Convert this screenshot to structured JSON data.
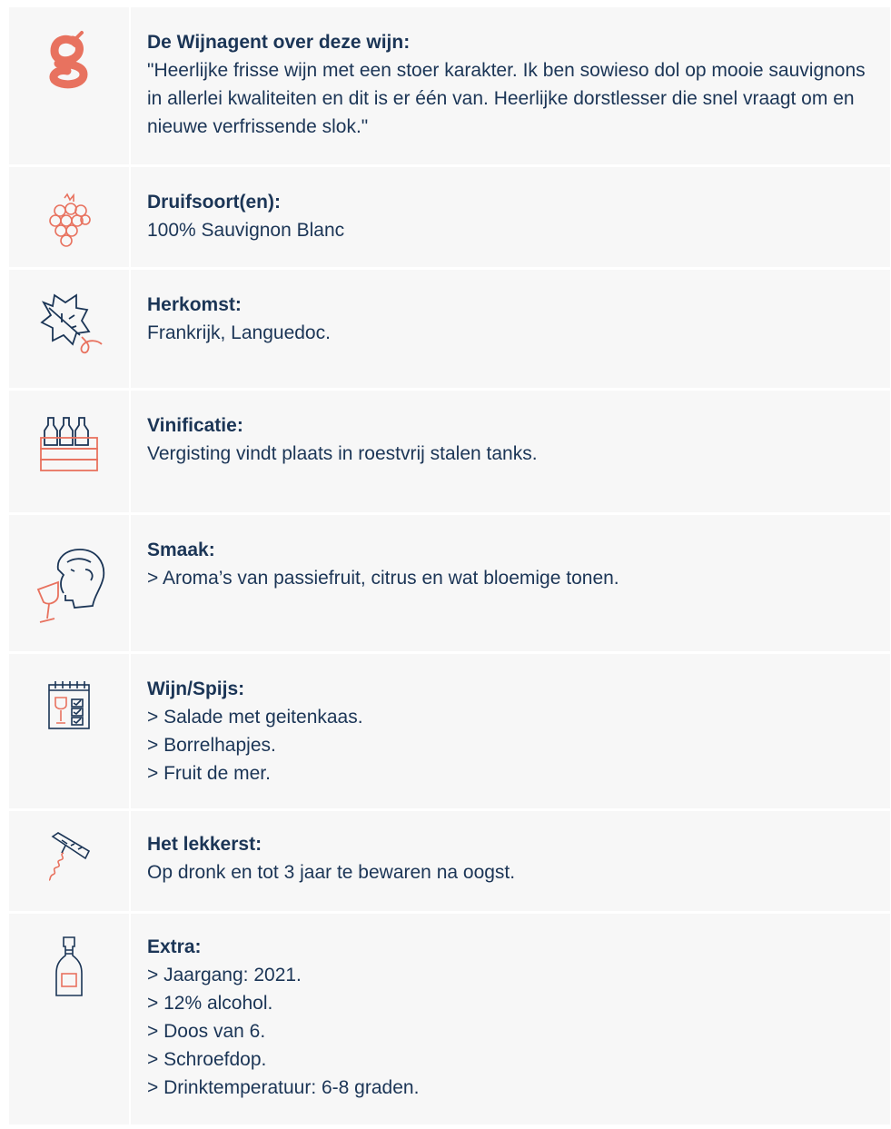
{
  "accent_color": "#e8725f",
  "navy_color": "#1b3556",
  "rows": [
    {
      "icon": "wijnagent-logo-icon",
      "label": "De Wijnagent over deze wijn:",
      "lines": [
        "\"Heerlijke frisse wijn met een stoer karakter. Ik ben sowieso dol op mooie sauvignons in allerlei kwaliteiten en dit is er één van. Heerlijke dorstlesser die snel vraagt om en nieuwe verfrissende slok.\""
      ]
    },
    {
      "icon": "grapes-icon",
      "label": "Druifsoort(en):",
      "lines": [
        "100% Sauvignon Blanc"
      ]
    },
    {
      "icon": "vine-leaf-icon",
      "label": "Herkomst:",
      "lines": [
        "Frankrijk, Languedoc."
      ]
    },
    {
      "icon": "wine-crate-icon",
      "label": "Vinificatie:",
      "lines": [
        "Vergisting vindt plaats in roestvrij stalen tanks."
      ]
    },
    {
      "icon": "tasting-head-icon",
      "label": "Smaak:",
      "lines": [
        "> Aroma’s van passiefruit, citrus en wat bloemige tonen."
      ]
    },
    {
      "icon": "menu-card-icon",
      "label": "Wijn/Spijs:",
      "lines": [
        "> Salade met geitenkaas.",
        "> Borrelhapjes.",
        "> Fruit de mer."
      ]
    },
    {
      "icon": "corkscrew-icon",
      "label": "Het lekkerst:",
      "lines": [
        "Op dronk en tot 3 jaar te bewaren na oogst."
      ]
    },
    {
      "icon": "wine-bottle-icon",
      "label": "Extra:",
      "lines": [
        "> Jaargang: 2021.",
        "> 12% alcohol.",
        "> Doos van 6.",
        "> Schroefdop.",
        "> Drinktemperatuur: 6-8 graden."
      ]
    }
  ]
}
